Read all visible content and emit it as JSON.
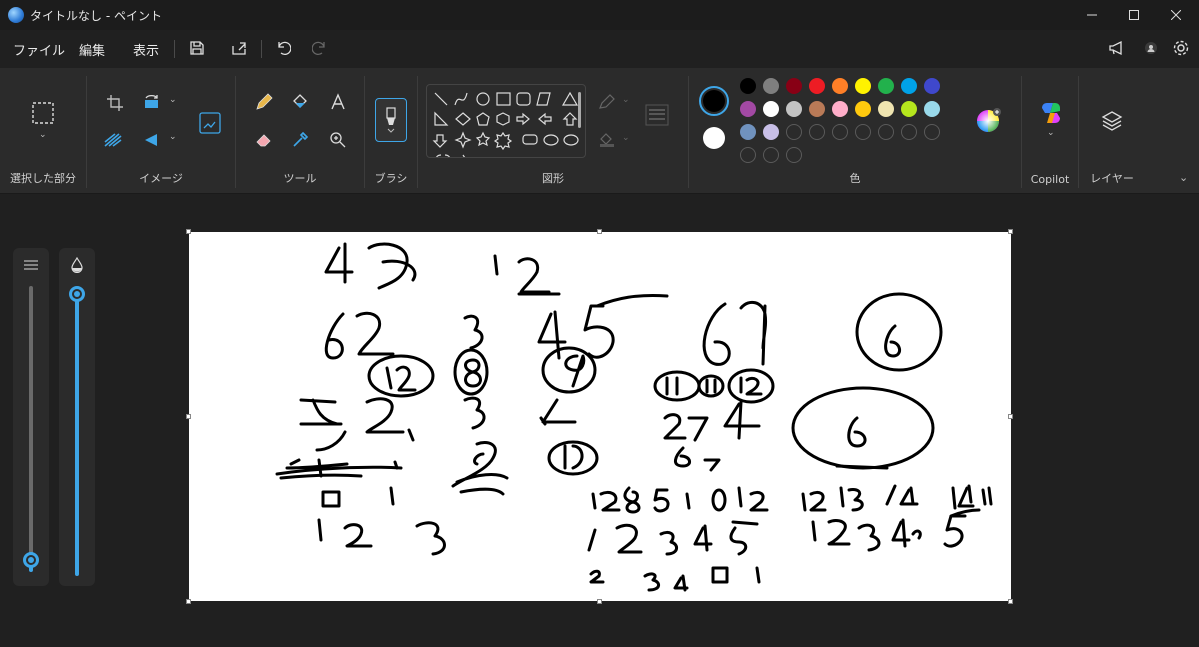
{
  "window": {
    "title": "タイトルなし - ペイント"
  },
  "menu": {
    "file": "ファイル",
    "edit": "編集",
    "view": "表示"
  },
  "ribbon": {
    "selection_label": "選択した部分",
    "image_label": "イメージ",
    "tools_label": "ツール",
    "brush_label": "ブラシ",
    "shapes_label": "図形",
    "colors_label": "色",
    "copilot_label": "Copilot",
    "layers_label": "レイヤー"
  },
  "colors": {
    "accent": "#3ea6e8",
    "primary": "#000000",
    "secondary": "#ffffff",
    "palette": [
      "#000000",
      "#7f7f7f",
      "#880015",
      "#ed1c24",
      "#ff7f27",
      "#fff200",
      "#22b14c",
      "#00a2e8",
      "#3f48cc",
      "#a349a4",
      "#ffffff",
      "#c3c3c3",
      "#b97a57",
      "#ffaec9",
      "#ffc90e",
      "#efe4b0",
      "#b5e61d",
      "#99d9ea",
      "#7092be",
      "#c8bfe7"
    ]
  },
  "canvas": {
    "drawing_description_icon": "handwritten-digits"
  }
}
